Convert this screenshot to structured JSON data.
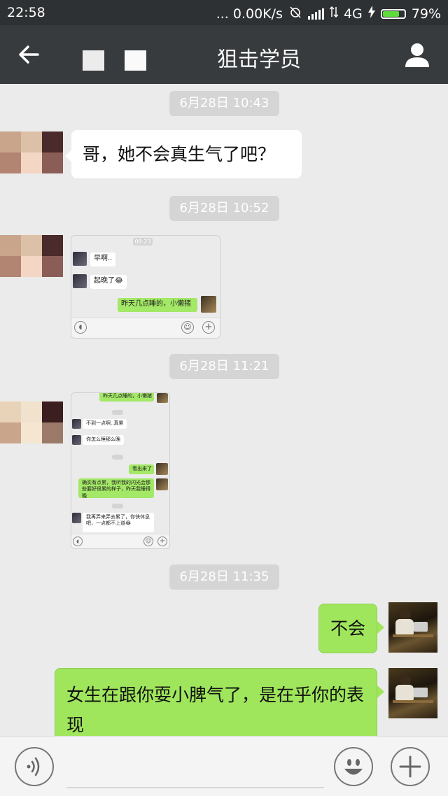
{
  "status_bar": {
    "time": "22:58",
    "network_speed": "... 0.00K/s",
    "network_type": "4G",
    "battery_percent": "79%",
    "battery_level": 0.79,
    "battery_color": "#5ddc3a"
  },
  "header": {
    "title": "狙击学员",
    "back_icon": "arrow-left-icon",
    "contact_icon": "person-icon"
  },
  "messages": [
    {
      "type": "timestamp",
      "text": "6月28日 10:43"
    },
    {
      "type": "received",
      "text": "哥，她不会真生气了吧？"
    },
    {
      "type": "timestamp",
      "text": "6月28日 10:52"
    },
    {
      "type": "received_image",
      "description_items": {
        "time": "09:23",
        "msgs": [
          "早啊..",
          "起晚了😂",
          "昨天几点睡的，小懒猪"
        ]
      }
    },
    {
      "type": "timestamp",
      "text": "6月28日 11:21"
    },
    {
      "type": "received_image",
      "description_items": {
        "msgs": [
          "昨天几点睡的，小懒猪",
          "不到一点啊..真累",
          "你怎么睡那么晚",
          "看出来了",
          "确实有点累，我听我的闪光会那些要好很累的样子，昨天我睡得晚",
          "我再弄来弄去累了，你快休息吧，一点都不上道😂"
        ]
      }
    },
    {
      "type": "timestamp",
      "text": "6月28日 11:35"
    },
    {
      "type": "sent",
      "text": "不会"
    },
    {
      "type": "sent",
      "text": "女生在跟你耍小脾气了，是在乎你的表现"
    }
  ],
  "colors": {
    "sent_bubble": "#9fe65c",
    "received_bubble": "#ffffff",
    "chat_background": "#ebebeb",
    "header_background": "#383b3e"
  },
  "input_bar": {
    "voice_icon": "voice-icon",
    "emoji_icon": "emoji-icon",
    "plus_icon": "plus-icon"
  }
}
